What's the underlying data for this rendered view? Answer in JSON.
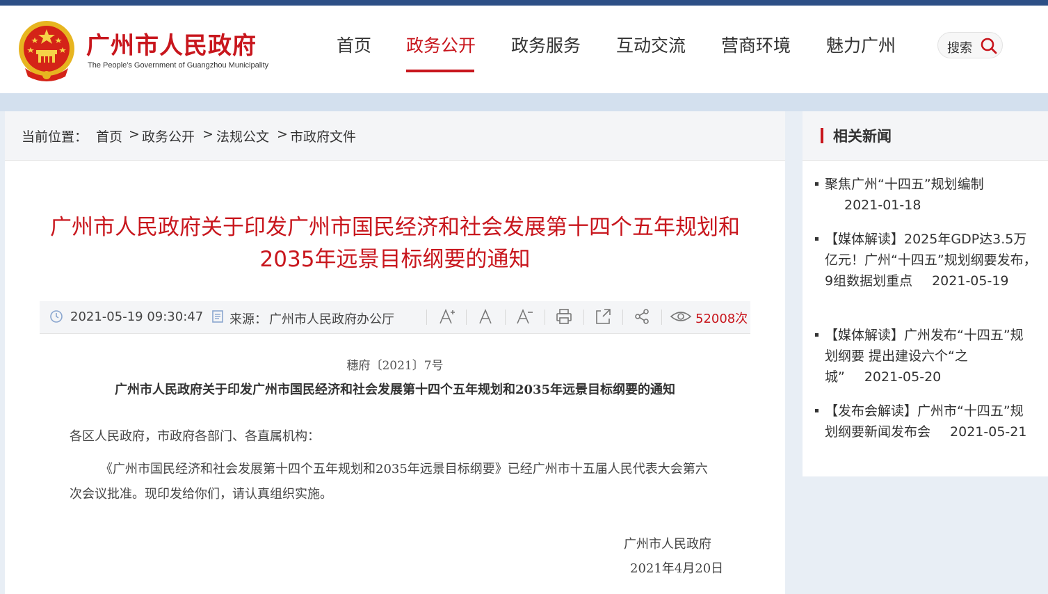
{
  "header": {
    "site_title": "广州市人民政府",
    "site_subtitle": "The People's Government of Guangzhou Municipality",
    "nav": [
      "首页",
      "政务公开",
      "政务服务",
      "互动交流",
      "营商环境",
      "魅力广州"
    ],
    "active_nav": "政务公开",
    "search_label": "搜索"
  },
  "breadcrumb": {
    "prefix": "当前位置：",
    "items": [
      "首页",
      "政务公开",
      "法规公文",
      "市政府文件"
    ],
    "separator": ">"
  },
  "article": {
    "title": "广州市人民政府关于印发广州市国民经济和社会发展第十四个五年规划和2035年远景目标纲要的通知",
    "datetime": "2021-05-19 09:30:47",
    "source_label": "来源：",
    "source": "广州市人民政府办公厅",
    "views": "52008次",
    "doc_number": "穗府〔2021〕7号",
    "doc_heading": "广州市人民政府关于印发广州市国民经济和社会发展第十四个五年规划和2035年远景目标纲要的通知",
    "salutation": "各区人民政府，市政府各部门、各直属机构：",
    "body": "《广州市国民经济和社会发展第十四个五年规划和2035年远景目标纲要》已经广州市十五届人民代表大会第六次会议批准。现印发给你们，请认真组织实施。",
    "signature": "广州市人民政府",
    "sign_date": "2021年4月20日"
  },
  "sidebar": {
    "title": "相关新闻",
    "news": [
      {
        "text": "聚焦广州“十四五”规划编制",
        "date": "2021-01-18"
      },
      {
        "text": "【媒体解读】2025年GDP达3.5万亿元！广州“十四五”规划纲要发布，9组数据划重点",
        "date": "2021-05-19"
      },
      {
        "text": "【媒体解读】广州发布“十四五”规划纲要 提出建设六个“之城”",
        "date": "2021-05-20"
      },
      {
        "text": "【发布会解读】广州市“十四五”规划纲要新闻发布会",
        "date": "2021-05-21"
      }
    ]
  },
  "colors": {
    "brand_red": "#c8161d",
    "top_bar": "#2d4f86",
    "background": "#e8eef5"
  },
  "icons": [
    "national-emblem",
    "search-icon",
    "clock-icon",
    "document-icon",
    "font-increase-icon",
    "font-normal-icon",
    "font-decrease-icon",
    "print-icon",
    "share-window-icon",
    "share-icon",
    "eye-icon"
  ]
}
